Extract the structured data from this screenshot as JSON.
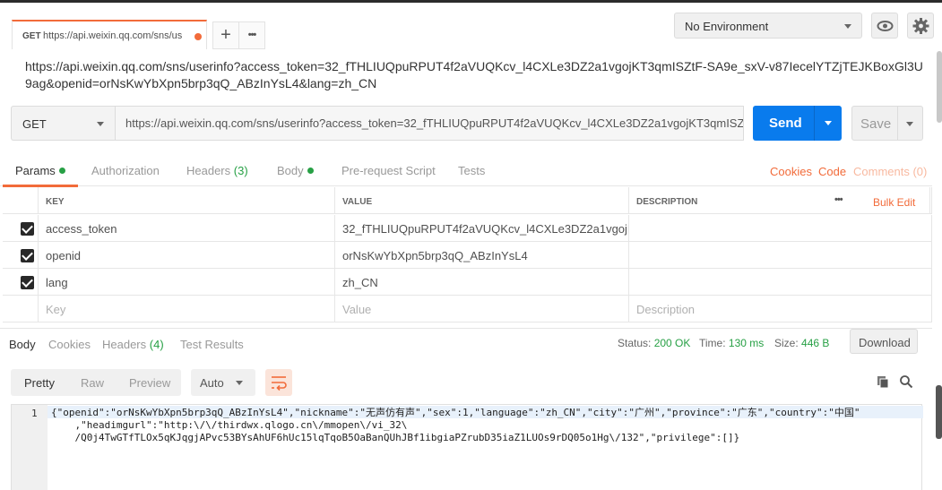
{
  "tab": {
    "method": "GET",
    "title": "https://api.weixin.qq.com/sns/us"
  },
  "tabbar": {
    "add_label": "+",
    "more_label": "•••"
  },
  "environment": {
    "selected": "No Environment"
  },
  "request_title": "https://api.weixin.qq.com/sns/userinfo?access_token=32_fTHLIUQpuRPUT4f2aVUQKcv_l4CXLe3DZ2a1vgojKT3qmISZtF-SA9e_sxV-v87IecelYTZjTEJKBoxGl3U9ag&openid=orNsKwYbXpn5brp3qQ_ABzInYsL4&lang=zh_CN",
  "request": {
    "method": "GET",
    "url": "https://api.weixin.qq.com/sns/userinfo?access_token=32_fTHLIUQpuRPUT4f2aVUQKcv_l4CXLe3DZ2a1vgojKT3qmISZtF-S...",
    "send_label": "Send",
    "save_label": "Save"
  },
  "request_tabs": {
    "params": "Params",
    "authorization": "Authorization",
    "headers": "Headers",
    "headers_count": "(3)",
    "body": "Body",
    "prerequest": "Pre-request Script",
    "tests": "Tests",
    "cookies": "Cookies",
    "code": "Code",
    "comments": "Comments (0)"
  },
  "params_table": {
    "col_key": "KEY",
    "col_value": "VALUE",
    "col_description": "DESCRIPTION",
    "more": "•••",
    "bulk_edit": "Bulk Edit",
    "rows": [
      {
        "key": "access_token",
        "value": "32_fTHLIUQpuRPUT4f2aVUQKcv_l4CXLe3DZ2a1vgojKT...",
        "checked": true
      },
      {
        "key": "openid",
        "value": "orNsKwYbXpn5brp3qQ_ABzInYsL4",
        "checked": true
      },
      {
        "key": "lang",
        "value": "zh_CN",
        "checked": true
      }
    ],
    "placeholder_key": "Key",
    "placeholder_value": "Value",
    "placeholder_description": "Description"
  },
  "response_tabs": {
    "body": "Body",
    "cookies": "Cookies",
    "headers": "Headers",
    "headers_count": "(4)",
    "test_results": "Test Results"
  },
  "response_status": {
    "status_label": "Status:",
    "status_value": "200 OK",
    "time_label": "Time:",
    "time_value": "130 ms",
    "size_label": "Size:",
    "size_value": "446 B",
    "download_label": "Download"
  },
  "formatter": {
    "pretty": "Pretty",
    "raw": "Raw",
    "preview": "Preview",
    "auto": "Auto"
  },
  "response_body": {
    "line_number": "1",
    "text": "{\"openid\":\"orNsKwYbXpn5brp3qQ_ABzInYsL4\",\"nickname\":\"无声仿有声\",\"sex\":1,\"language\":\"zh_CN\",\"city\":\"广州\",\"province\":\"广东\",\"country\":\"中国\"\n    ,\"headimgurl\":\"http:\\/\\/thirdwx.qlogo.cn\\/mmopen\\/vi_32\\\n    /Q0j4TwGTfTLOx5qKJqgjAPvc53BYsAhUF6hUc15lqTqoB5OaBanQUhJBf1ibgiaPZrubD35iaZ1LUOs9rDQ05o1Hg\\/132\",\"privilege\":[]}"
  },
  "colors": {
    "accent": "#f26b3a",
    "send": "#097bed",
    "success": "#27a045"
  }
}
